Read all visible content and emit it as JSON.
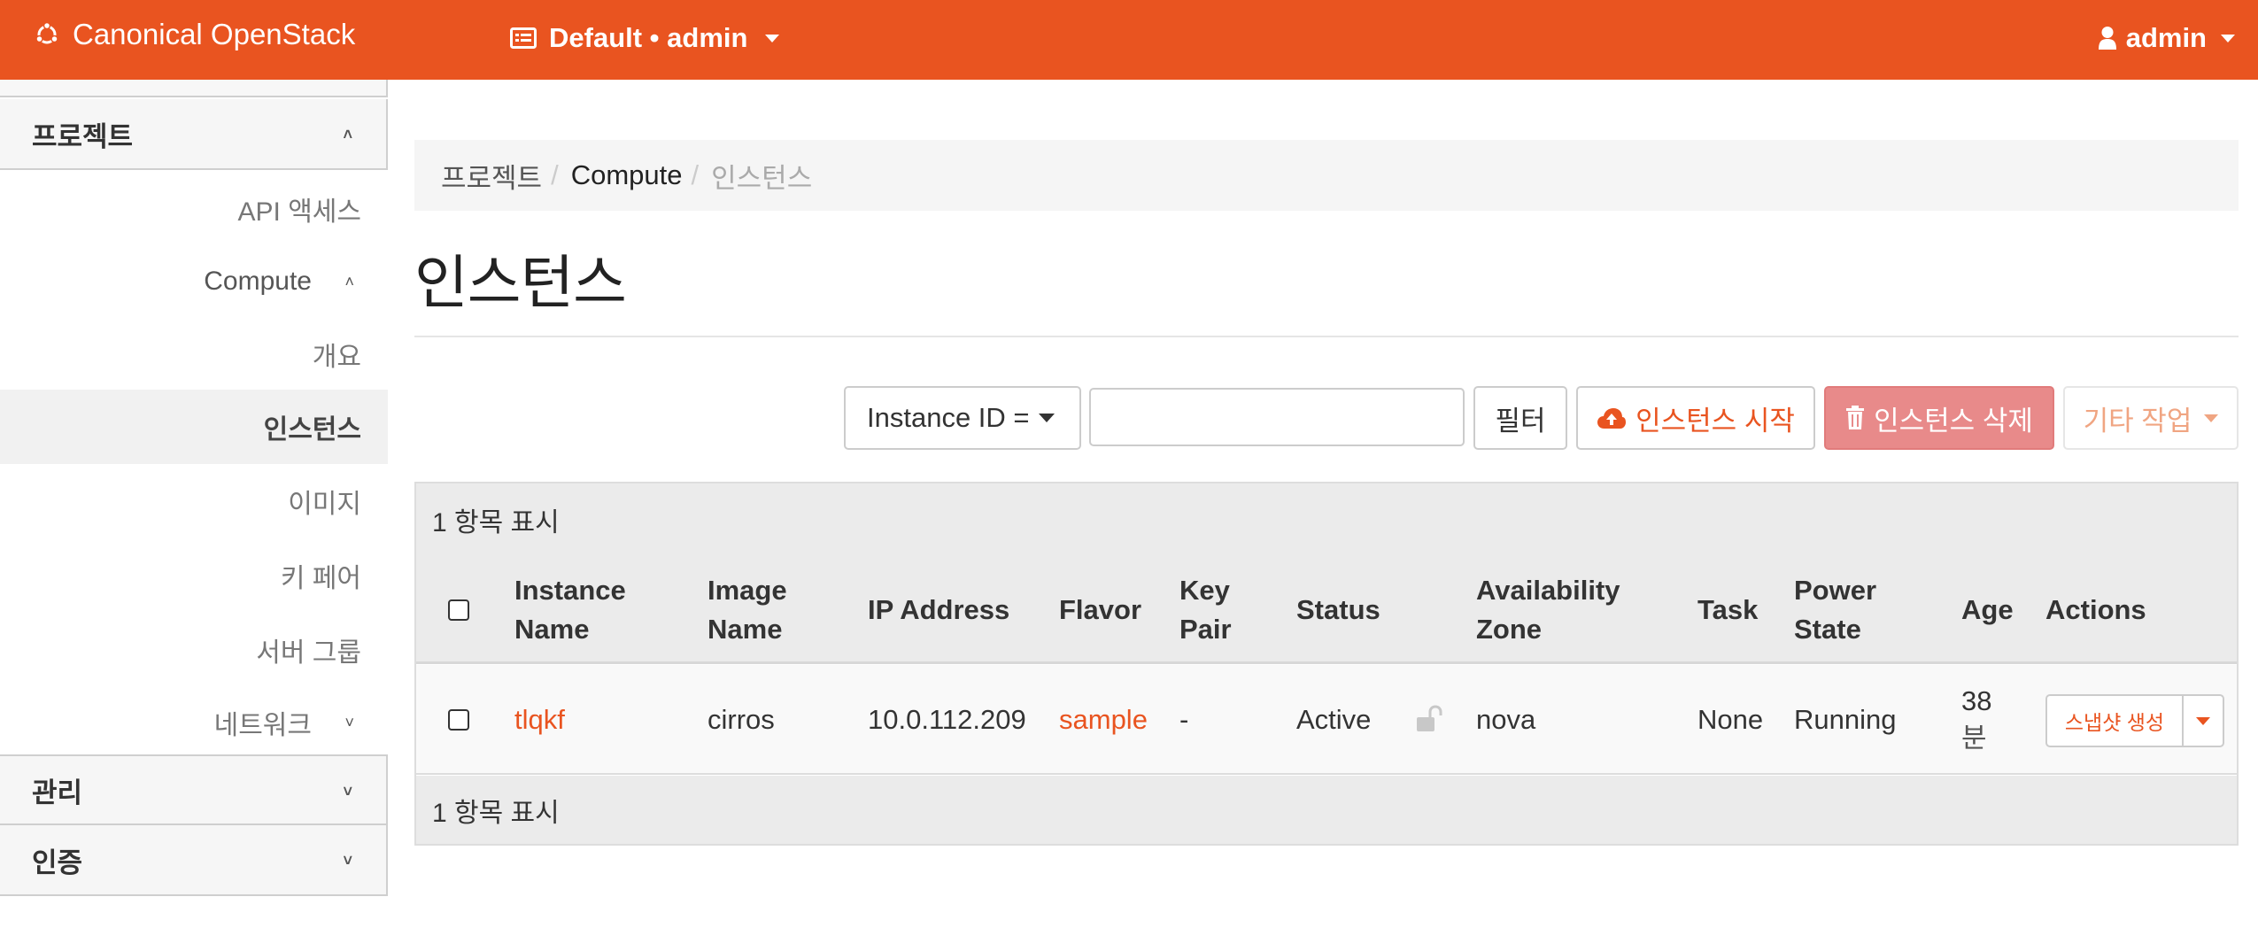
{
  "navbar": {
    "brand": "Canonical OpenStack",
    "project_switch": "Default • admin",
    "user": "admin",
    "colors": {
      "accent": "#e95420"
    }
  },
  "sidebar": {
    "project_header": "프로젝트",
    "api_access": "API 액세스",
    "compute_group": "Compute",
    "compute_items": [
      "개요",
      "인스턴스",
      "이미지",
      "키 페어",
      "서버 그룹"
    ],
    "active_item": "인스턴스",
    "network_group": "네트워크",
    "admin_header": "관리",
    "identity_header": "인증"
  },
  "breadcrumb": [
    "프로젝트",
    "Compute",
    "인스턴스"
  ],
  "breadcrumb_separator": "/",
  "page_title": "인스턴스",
  "toolbar": {
    "filter_field": "Instance ID =",
    "filter_input_value": "",
    "filter_button": "필터",
    "launch_button": "인스턴스 시작",
    "delete_button": "인스턴스 삭제",
    "more_actions": "기타 작업"
  },
  "table": {
    "count_label": "1 항목 표시",
    "headers": {
      "instance_name": [
        "Instance",
        "Name"
      ],
      "image_name": [
        "Image",
        "Name"
      ],
      "ip_address": "IP Address",
      "flavor": "Flavor",
      "key_pair": [
        "Key",
        "Pair"
      ],
      "status": "Status",
      "availability_zone": [
        "Availability",
        "Zone"
      ],
      "task": "Task",
      "power_state": [
        "Power",
        "State"
      ],
      "age": "Age",
      "actions": "Actions"
    },
    "rows": [
      {
        "instance_name": "tlqkf",
        "image_name": "cirros",
        "ip_address": "10.0.112.209",
        "flavor": "sample",
        "key_pair": "-",
        "status": "Active",
        "locked": false,
        "availability_zone": "nova",
        "task": "None",
        "power_state": "Running",
        "age": [
          "38",
          "분"
        ],
        "action_button": "스냅샷 생성"
      }
    ]
  }
}
